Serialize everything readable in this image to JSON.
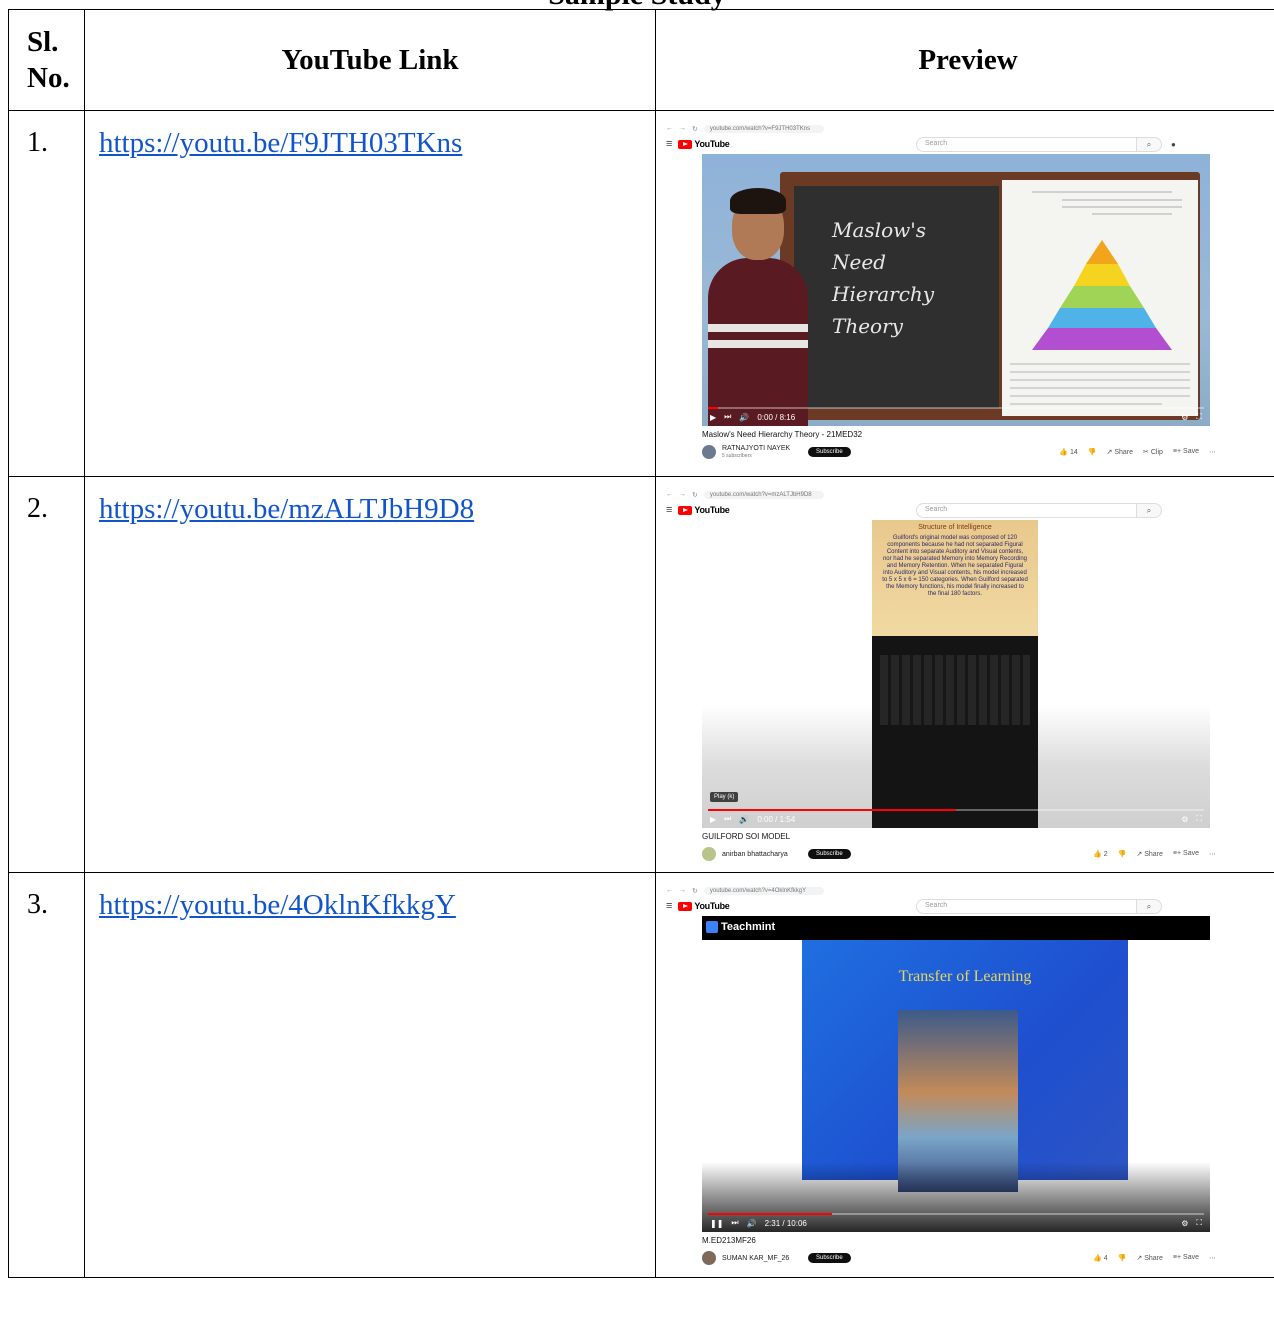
{
  "cut_title": "Sample Study",
  "table": {
    "headers": {
      "sl": "Sl. No.",
      "link": "YouTube Link",
      "preview": "Preview"
    },
    "rows": [
      {
        "num": "1.",
        "link": "https://youtu.be/F9JTH03TKns",
        "preview": {
          "address": "youtube.com/watch?v=F9JTH03TKns",
          "search_placeholder": "Search",
          "video_title": "Maslow's Need Hierarchy Theory - 21MED32",
          "channel": "RATNAJYOTI NAYEK",
          "subscribers": "5 subscribers",
          "subscribe": "Subscribe",
          "likes": "14",
          "share": "Share",
          "clip": "Clip",
          "save": "Save",
          "time": "0:00 / 8:16",
          "progress": 0.02,
          "board_lines": [
            "Maslow's",
            "Need",
            "Hierarchy",
            "Theory"
          ]
        }
      },
      {
        "num": "2.",
        "link": "https://youtu.be/mzALTJbH9D8",
        "preview": {
          "address": "youtube.com/watch?v=mzALTJbH9D8",
          "search_placeholder": "Search",
          "video_title": "GUILFORD SOI MODEL",
          "channel": "anirban bhattacharya",
          "subscribe": "Subscribe",
          "likes": "2",
          "share": "Share",
          "save": "Save",
          "time": "0:00 / 1:54",
          "progress": 0.5,
          "badge": "Play (k)",
          "slide_heading": "Structure of Intelligence",
          "slide_text": "Guilford's original model was composed of 120 components because he had not separated Figural Content into separate Auditory and Visual contents, nor had he separated Memory into Memory Recording and Memory Retention. When he separated Figural into Auditory and Visual contents, his model increased to 5 x 5 x 6 = 150 categories. When Guilford separated the Memory functions, his model finally increased to the final 180 factors."
        }
      },
      {
        "num": "3.",
        "link": "https://youtu.be/4OklnKfkkgY",
        "preview": {
          "address": "youtube.com/watch?v=4OklnKfkkgY",
          "search_placeholder": "Search",
          "video_title": "M.ED213MF26",
          "channel": "SUMAN KAR_MF_26",
          "subscribe": "Subscribe",
          "likes": "4",
          "share": "Share",
          "save": "Save",
          "time": "2:31 / 10:06",
          "progress": 0.25,
          "brand": "Teachmint",
          "slide_title": "Transfer of Learning"
        }
      }
    ]
  },
  "colors": {
    "link": "#1155cc",
    "youtube_red": "#ff0000",
    "border": "#000000"
  }
}
